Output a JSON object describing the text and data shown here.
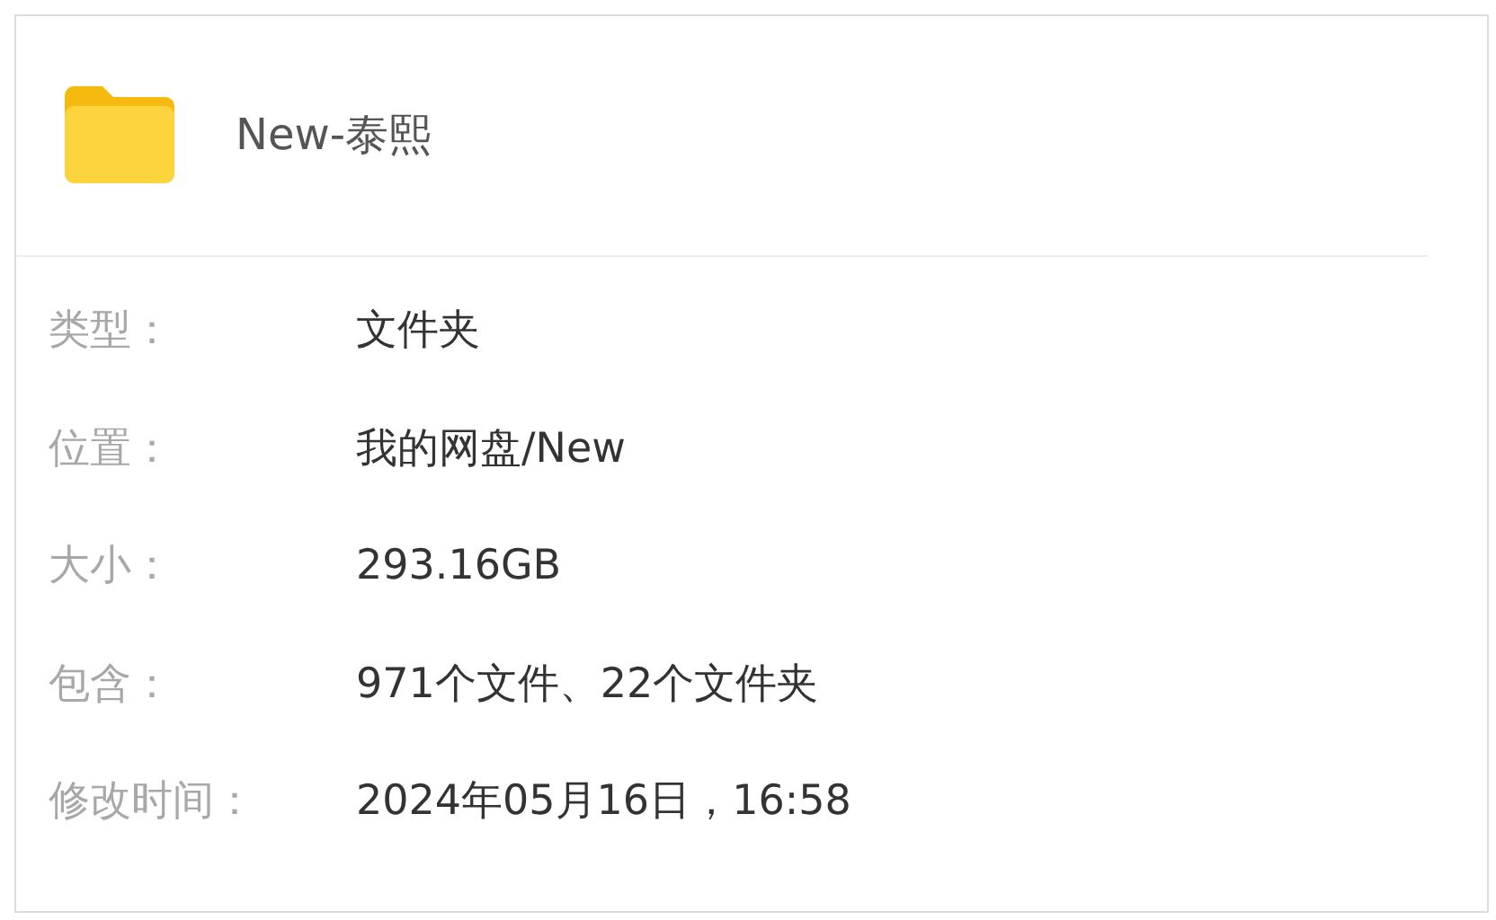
{
  "folder": {
    "name": "New-泰熙"
  },
  "properties": [
    {
      "label": "类型：",
      "value": "文件夹"
    },
    {
      "label": "位置：",
      "value": "我的网盘/New"
    },
    {
      "label": "大小：",
      "value": "293.16GB"
    },
    {
      "label": "包含：",
      "value": "971个文件、22个文件夹"
    },
    {
      "label": "修改时间：",
      "value": "2024年05月16日，16:58"
    }
  ]
}
